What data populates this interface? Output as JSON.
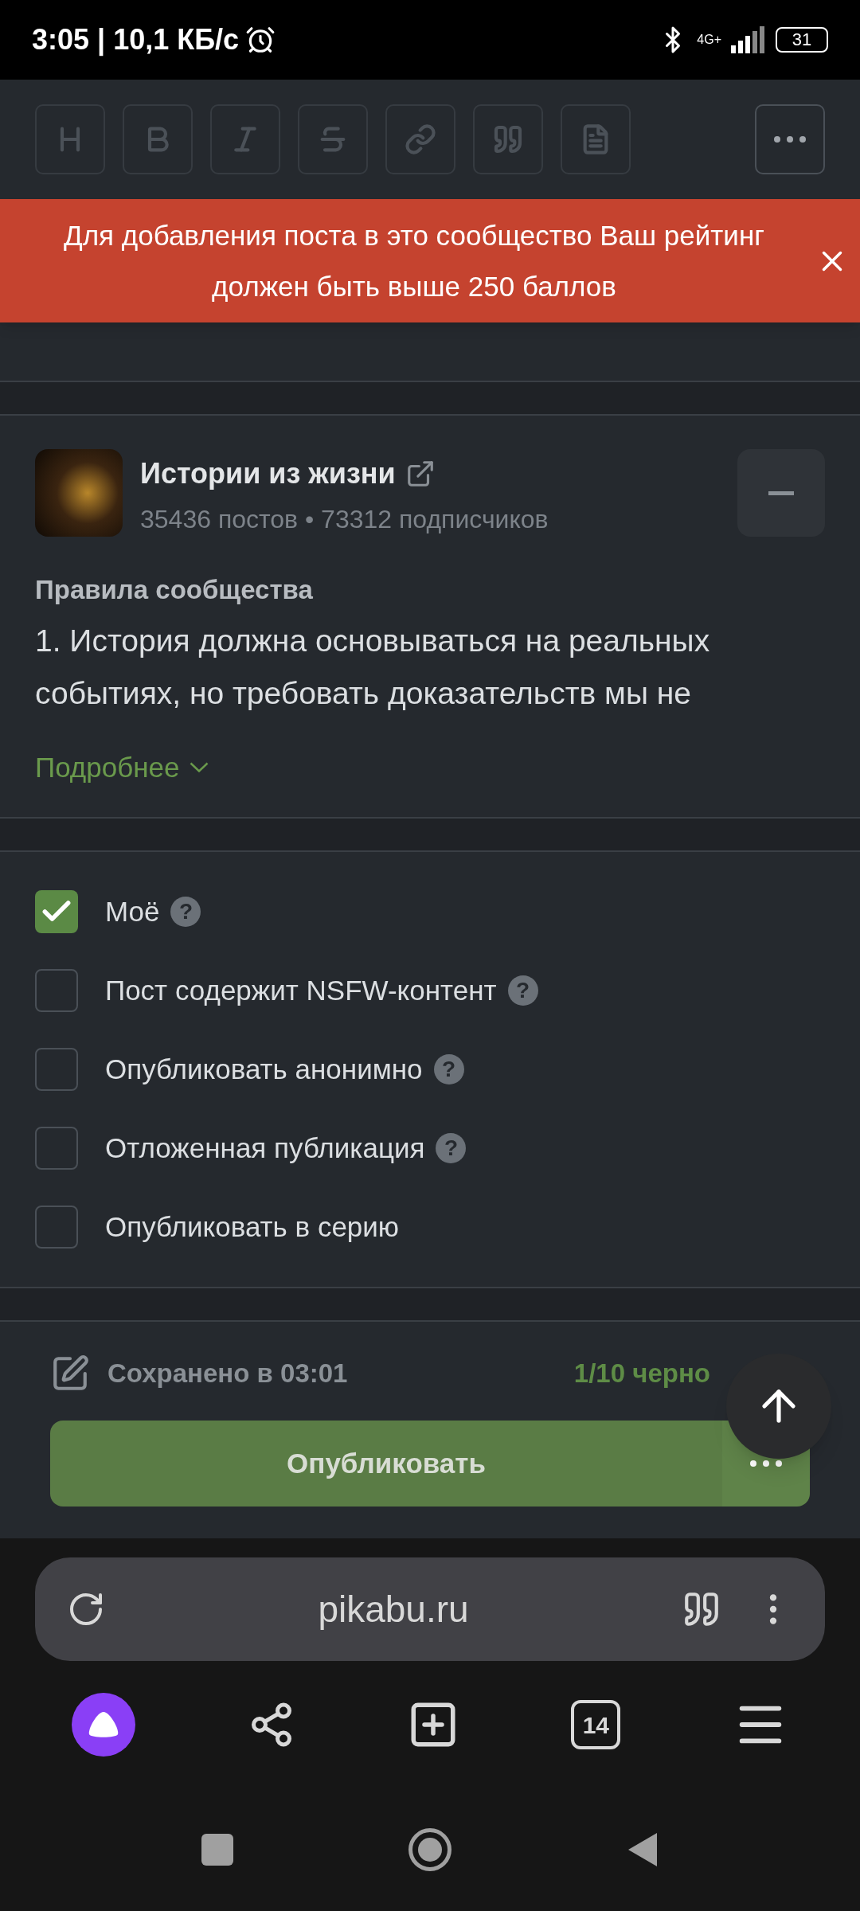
{
  "status_bar": {
    "time": "3:05 | 10,1 КБ/с",
    "network": "4G+",
    "battery": "31"
  },
  "banner": {
    "message": "Для добавления поста в это сообщество Ваш рейтинг должен быть выше 250 баллов"
  },
  "community": {
    "name": "Истории из жизни",
    "stats": "35436 постов • 73312 подписчиков",
    "rules_title": "Правила сообщества",
    "rules_lines": [
      "1. История должна основываться на реальных",
      "событиях, но требовать доказательств мы не"
    ],
    "more": "Подробнее"
  },
  "options": [
    {
      "label": "Моё",
      "checked": true,
      "help": "?"
    },
    {
      "label": "Пост содержит NSFW-контент",
      "checked": false,
      "help": "?"
    },
    {
      "label": "Опубликовать анонимно",
      "checked": false,
      "help": "?"
    },
    {
      "label": "Отложенная публикация",
      "checked": false,
      "help": "?"
    },
    {
      "label": "Опубликовать в серию",
      "checked": false
    }
  ],
  "footer": {
    "saved": "Сохранено в 03:01",
    "drafts": "1/10 черно",
    "publish": "Опубликовать"
  },
  "browser": {
    "url": "pikabu.ru",
    "tabs_count": "14"
  }
}
